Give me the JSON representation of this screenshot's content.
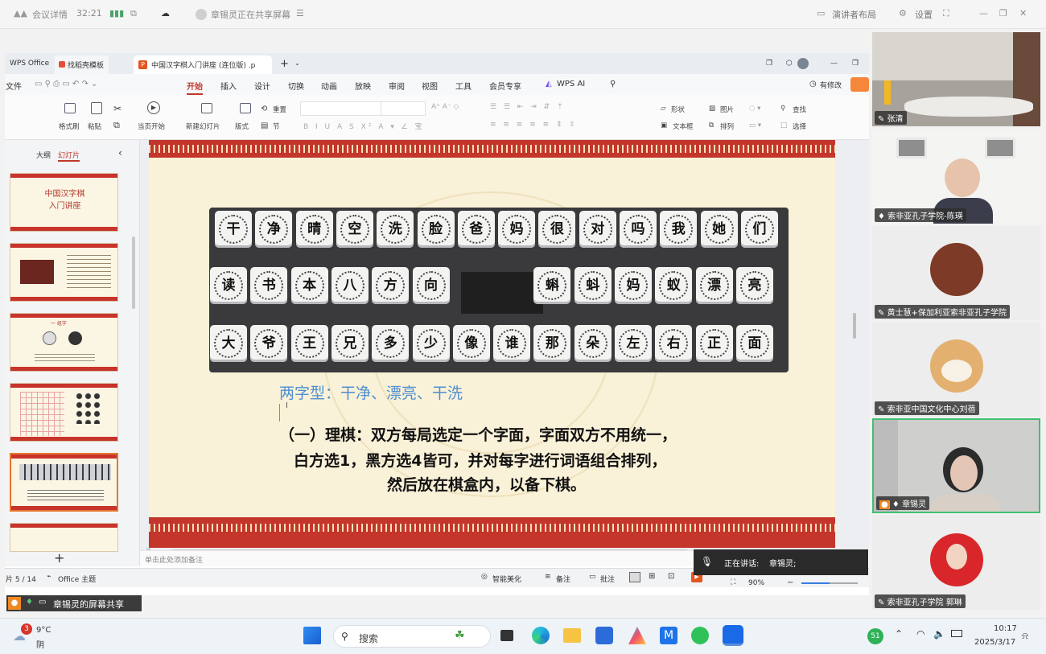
{
  "meeting": {
    "details_label": "会议详情",
    "timer": "32:21",
    "sharing_text": "章锡灵正在共享屏幕",
    "presenter_layout": "演讲者布局",
    "settings": "设置",
    "speaking_label": "正在讲话:",
    "speaker_name": "章锡灵;",
    "screen_share_label": "章锡灵的屏幕共享"
  },
  "wps": {
    "tabs": [
      "WPS Office",
      "找稻壳模板",
      "中国汉字棋入门讲座 (连位版) .p"
    ],
    "menu": [
      "文件",
      "开始",
      "插入",
      "设计",
      "切换",
      "动画",
      "放映",
      "审阅",
      "视图",
      "工具",
      "会员专享",
      "WPS AI"
    ],
    "revise_label": "有修改",
    "ribbon": {
      "format_painter": "格式刷",
      "paste": "粘贴",
      "play_from_current": "当页开始",
      "new_slide": "新建幻灯片",
      "layout": "版式",
      "section": "节",
      "reset": "重置",
      "shape": "形状",
      "picture": "图片",
      "textbox": "文本框",
      "arrange": "排列",
      "find": "查找",
      "select": "选择"
    },
    "panel_tabs": [
      "大纲",
      "幻灯片"
    ],
    "notes_placeholder": "单击此处添加备注",
    "status": {
      "page": "片 5 / 14",
      "theme": "Office 主题",
      "smart_beautify": "智能美化",
      "notes": "备注",
      "comments": "批注",
      "zoom": "90%"
    }
  },
  "thumbnails": [
    {
      "title": "中国汉字棋\n入门讲座"
    },
    {
      "title": ""
    },
    {
      "title": "一 组字"
    },
    {
      "title": ""
    },
    {
      "title": ""
    },
    {
      "title": ""
    }
  ],
  "slide": {
    "rows": [
      [
        "干",
        "净",
        "晴",
        "空",
        "洗",
        "脸",
        "爸",
        "妈",
        "很",
        "对",
        "吗",
        "我",
        "她",
        "们"
      ],
      [
        "读",
        "书",
        "本",
        "八",
        "方",
        "向",
        "",
        "",
        "蝌",
        "蚪",
        "妈",
        "蚁",
        "漂",
        "亮"
      ],
      [
        "大",
        "爷",
        "王",
        "兄",
        "多",
        "少",
        "像",
        "谁",
        "那",
        "朵",
        "左",
        "右",
        "正",
        "面"
      ]
    ],
    "blue_line": "两字型：干净、漂亮、干洗",
    "cursor_char": "I",
    "body_line1": "（一）理棋：双方每局选定一个字面，字面双方不用统一，",
    "body_line2": "白方选1，黑方选4皆可，并对每字进行词语组合排列，",
    "body_line3": "然后放在棋盒内，以备下棋。"
  },
  "participants": [
    {
      "name": "张清"
    },
    {
      "name": "索非亚孔子学院-陈瑛"
    },
    {
      "name": "黄士慧+保加利亚索非亚孔子学院"
    },
    {
      "name": "索非亚中国文化中心刘蓓"
    },
    {
      "name": "章锡灵"
    },
    {
      "name": "索非亚孔子学院  郭琳"
    }
  ],
  "taskbar": {
    "weather_temp": "9°C",
    "weather_desc": "阴",
    "weather_badge": "3",
    "search": "搜索",
    "time": "10:17",
    "date": "2025/3/17",
    "battery_badge": "51"
  }
}
